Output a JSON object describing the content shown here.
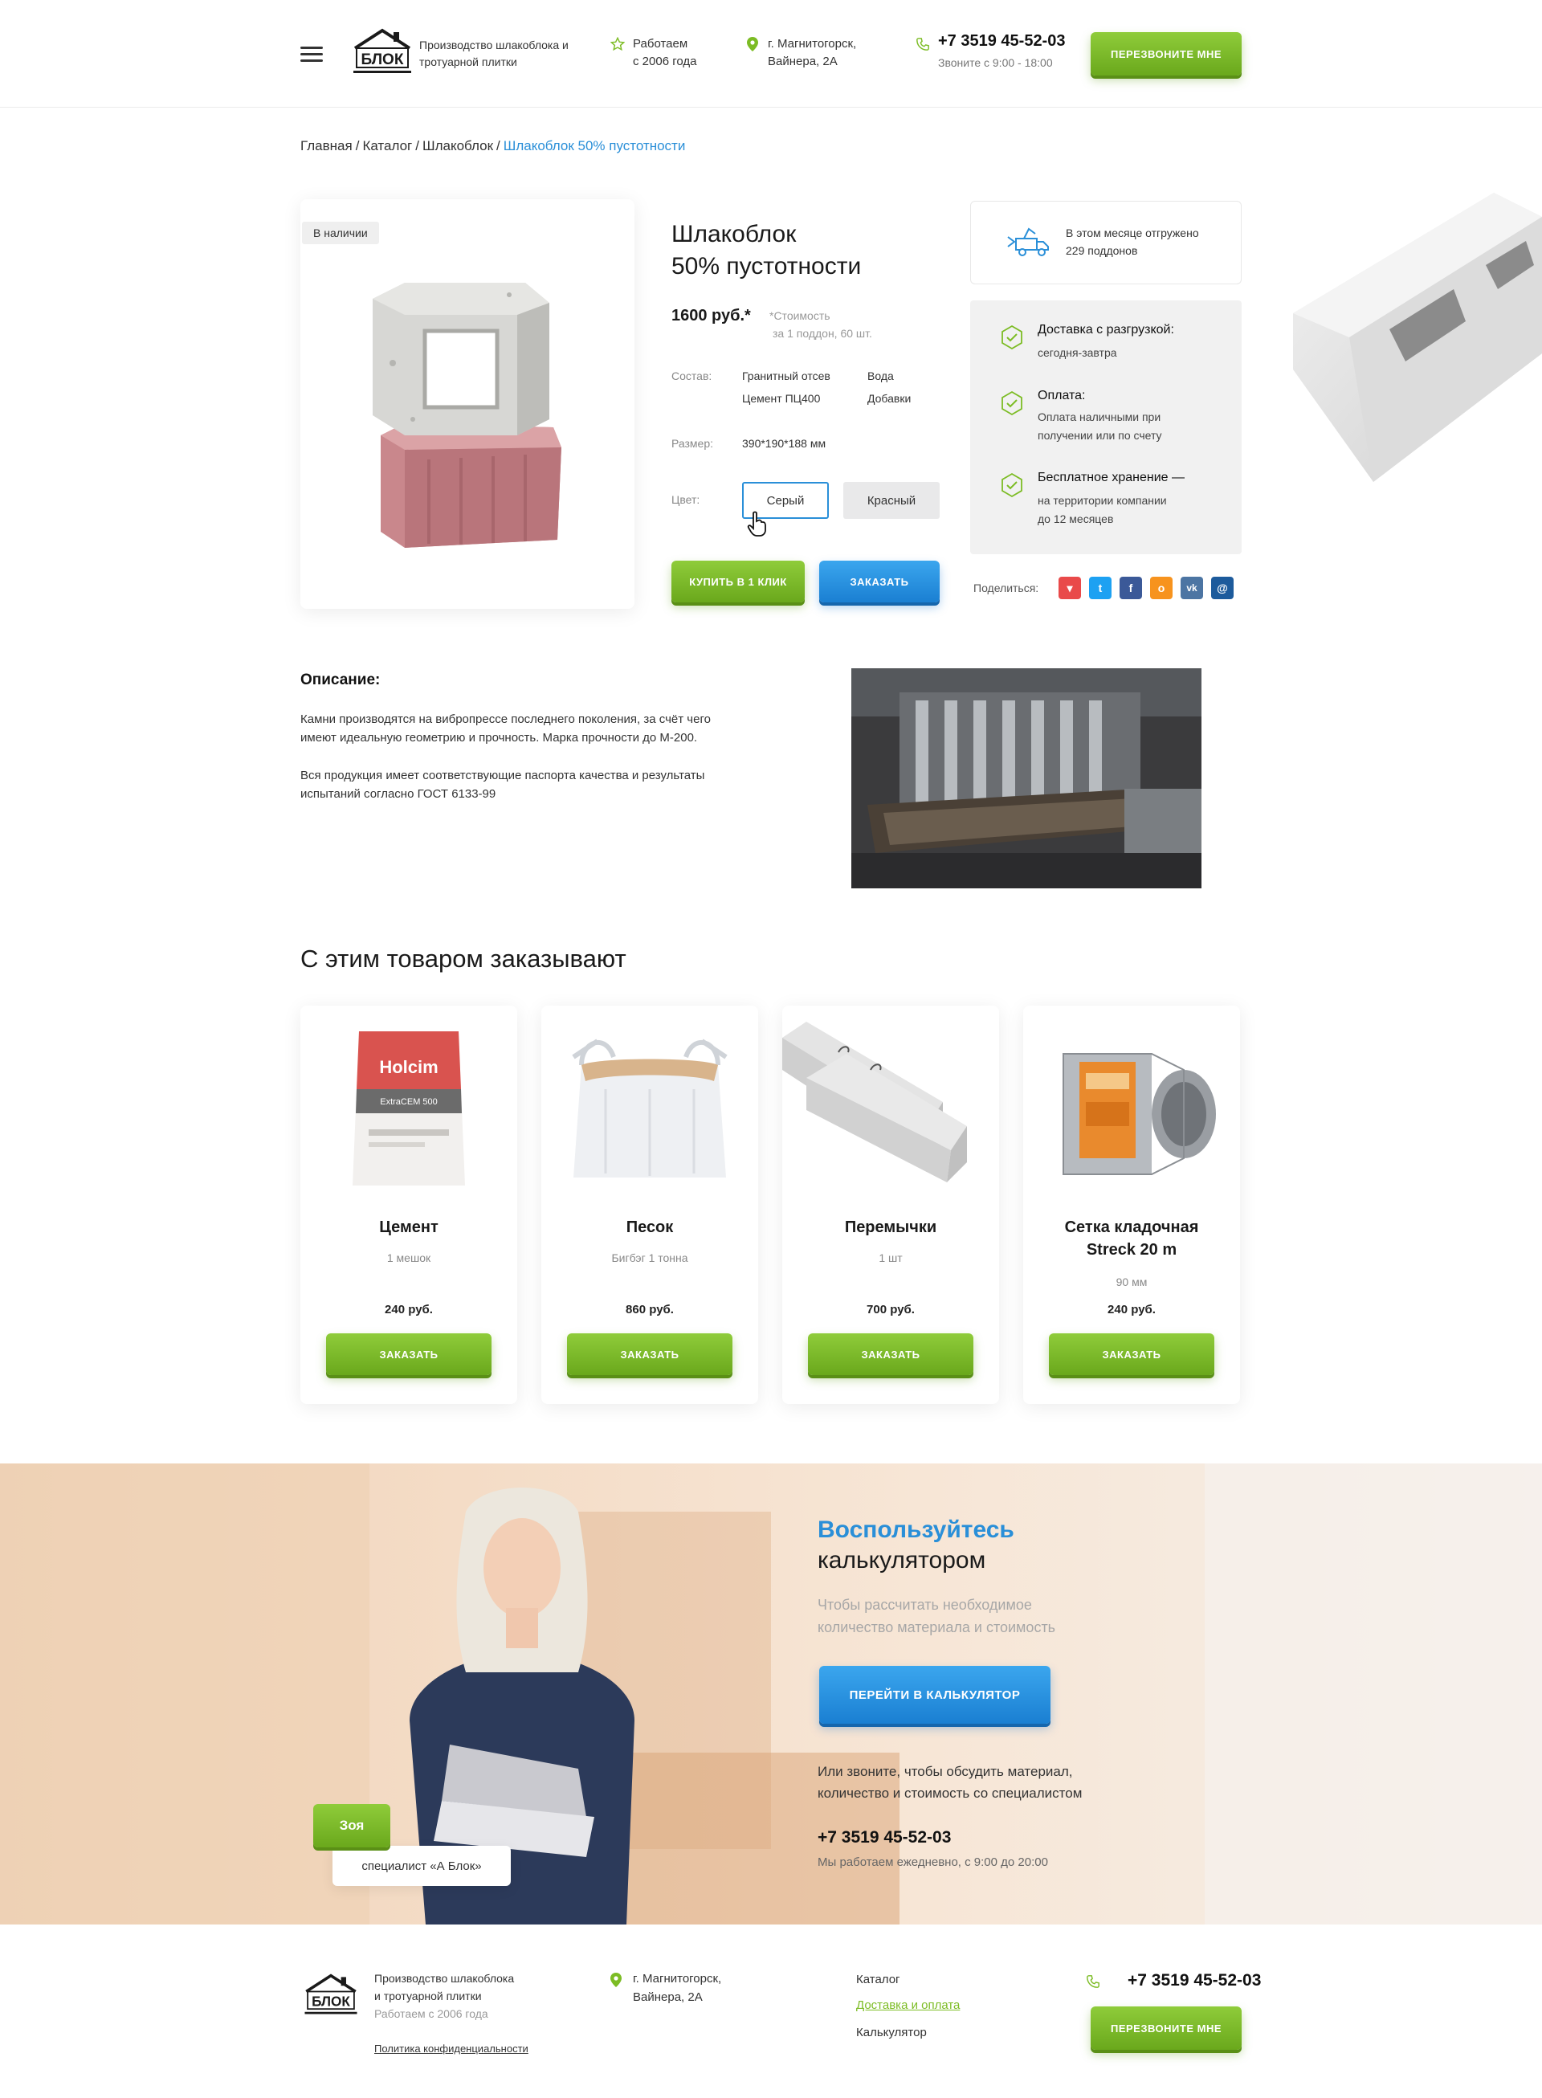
{
  "header": {
    "logo_text": "БЛОК",
    "tagline": "Производство шлакоблока и тротуарной плитки",
    "work_since_line1": "Работаем",
    "work_since_line2": "с 2006 года",
    "address_line1": "г. Магнитогорск,",
    "address_line2": "Вайнера, 2А",
    "phone": "+7 3519 45-52-03",
    "hours": "Звоните с 9:00 - 18:00",
    "callback_button": "Перезвоните мне"
  },
  "breadcrumb": {
    "items": [
      "Главная",
      "Каталог",
      "Шлакоблок"
    ],
    "current": "Шлакоблок 50% пустотности"
  },
  "product": {
    "stock_badge": "В наличии",
    "title_line1": "Шлакоблок",
    "title_line2": "50% пустотности",
    "price": "1600 руб.*",
    "price_note_line1": "*Стоимость",
    "price_note_line2": "за 1 поддон, 60 шт.",
    "composition_label": "Состав:",
    "composition": [
      "Гранитный отсев",
      "Вода",
      "Цемент ПЦ400",
      "Добавки"
    ],
    "size_label": "Размер:",
    "size": "390*190*188 мм",
    "color_label": "Цвет:",
    "colors": [
      "Серый",
      "Красный"
    ],
    "selected_color": "Серый",
    "buy_one_click": "Купить в 1 клик",
    "order_button": "Заказать"
  },
  "shipped": {
    "line1": "В этом месяце отгружено",
    "line2": "229 поддонов"
  },
  "benefits": [
    {
      "title": "Доставка с разгрузкой:",
      "desc": [
        "сегодня-завтра"
      ]
    },
    {
      "title": "Оплата:",
      "desc": [
        "Оплата наличными при",
        "получении или по счету"
      ]
    },
    {
      "title": "Бесплатное хранение —",
      "desc": [
        "на территории компании",
        "до 12 месяцев"
      ]
    }
  ],
  "share": {
    "label": "Поделиться:",
    "icons": [
      {
        "name": "bookmark-icon",
        "color": "#e94a4a",
        "glyph": "▾"
      },
      {
        "name": "twitter-icon",
        "color": "#1da1f2",
        "glyph": "t"
      },
      {
        "name": "facebook-icon",
        "color": "#3b5998",
        "glyph": "f"
      },
      {
        "name": "odnoklassniki-icon",
        "color": "#f7931e",
        "glyph": "о"
      },
      {
        "name": "vk-icon",
        "color": "#4c75a3",
        "glyph": "vk"
      },
      {
        "name": "moimir-icon",
        "color": "#1d5b9c",
        "glyph": "@"
      }
    ]
  },
  "description": {
    "title": "Описание:",
    "p1_line1": "Камни производятся на вибропрессе последнего поколения, за счёт чего",
    "p1_line2": "имеют идеальную геометрию и прочность. Марка прочности до М-200.",
    "p2_line1": "Вся продукция имеет соответствующие паспорта качества и результаты",
    "p2_line2": "испытаний согласно ГОСТ 6133-99"
  },
  "related": {
    "title": "С этим товаром заказывают",
    "items": [
      {
        "name_line1": "Цемент",
        "name_line2": "",
        "sub": "1 мешок",
        "price": "240 руб.",
        "button": "Заказать",
        "image_text": "Holcim",
        "image_subtext": "ExtraCEM 500"
      },
      {
        "name_line1": "Песок",
        "name_line2": "",
        "sub": "Бигбэг 1 тонна",
        "price": "860 руб.",
        "button": "Заказать"
      },
      {
        "name_line1": "Перемычки",
        "name_line2": "",
        "sub": "1 шт",
        "price": "700 руб.",
        "button": "Заказать"
      },
      {
        "name_line1": "Сетка кладочная",
        "name_line2": "Streck 20 m",
        "sub": "90 мм",
        "price": "240 руб.",
        "button": "Заказать"
      }
    ]
  },
  "calculator": {
    "title_line1": "Воспользуйтесь",
    "title_line2": "калькулятором",
    "desc_line1": "Чтобы рассчитать необходимое",
    "desc_line2": "количество материала и стоимость",
    "button": "Перейти в калькулятор",
    "or_line1": "Или звоните, чтобы обсудить материал,",
    "or_line2": "количество и стоимость со специалистом",
    "phone": "+7 3519 45-52-03",
    "hours": "Мы работаем ежедневно, с 9:00 до 20:00",
    "specialist_name": "Зоя",
    "specialist_role": "специалист «А Блок»"
  },
  "footer": {
    "logo_text": "БЛОК",
    "tagline_line1": "Производство шлакоблока",
    "tagline_line2": "и тротуарной плитки",
    "since": "Работаем с 2006 года",
    "privacy": "Политика конфиденциальности",
    "address_line1": "г. Магнитогорск,",
    "address_line2": "Вайнера, 2А",
    "links": [
      "Каталог",
      "Доставка и оплата",
      "Калькулятор"
    ],
    "phone": "+7 3519 45-52-03",
    "callback_button": "Перезвоните мне"
  },
  "colors": {
    "accent_green": "#7cbc24",
    "accent_blue": "#2a8fd8"
  }
}
